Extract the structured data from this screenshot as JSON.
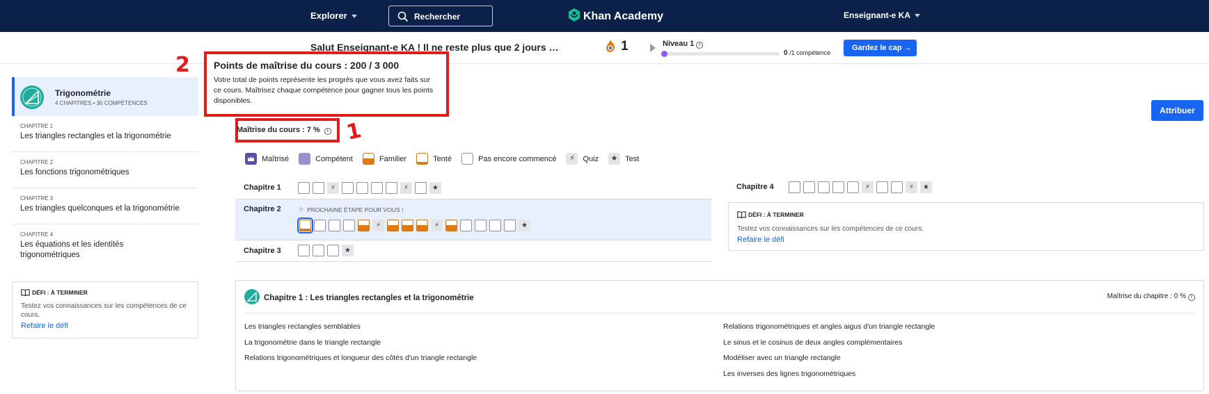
{
  "nav": {
    "explore": "Explorer",
    "search": "Rechercher",
    "logo": "Khan Academy",
    "user": "Enseignant-e KA"
  },
  "greeting": {
    "text": "Salut Enseignant-e KA ! Il ne reste plus que 2 jours …",
    "streak": "1",
    "level": "Niveau 1",
    "level_progress": 0.01,
    "competence_done": "0",
    "competence_total": "/1 compétence",
    "keep_going": "Gardez le cap"
  },
  "sidebar": {
    "course_title": "Trigonométrie",
    "course_meta": "4 CHAPITRES • 30 COMPÉTENCES",
    "units": [
      {
        "label": "CHAPITRE 1",
        "name": "Les triangles rectangles et la trigonométrie"
      },
      {
        "label": "CHAPITRE 2",
        "name": "Les fonctions trigonométriques"
      },
      {
        "label": "CHAPITRE 3",
        "name": "Les triangles quelconques et la trigonométrie"
      },
      {
        "label": "CHAPITRE 4",
        "name": "Les équations et les identités trigonométriques"
      }
    ],
    "challenge": {
      "head": "DÉFI : À TERMINER",
      "text": "Testez vos connaissances sur les compétences de ce cours.",
      "link": "Refaire le défi"
    }
  },
  "tooltip": {
    "title": "Points de maîtrise du cours : 200 / 3 000",
    "text": "Votre total de points représente les progrès que vous avez faits sur ce cours. Maîtrisez chaque compétence pour gagner tous les points disponibles."
  },
  "annotations": {
    "one": "1",
    "two": "2"
  },
  "mastery": {
    "label": "Maîtrise du cours : 7 %"
  },
  "assign": "Attribuer",
  "legend": {
    "mastered": "Maîtrisé",
    "proficient": "Compétent",
    "familiar": "Familier",
    "attempted": "Tenté",
    "not_started": "Pas encore commencé",
    "quiz": "Quiz",
    "test": "Test"
  },
  "chapters": {
    "ch1": {
      "name": "Chapitre 1",
      "boxes": [
        "e",
        "e",
        "q",
        "e",
        "e",
        "e",
        "e",
        "q",
        "e",
        "t"
      ]
    },
    "ch2": {
      "name": "Chapitre 2",
      "next": "PROCHAINE ÉTAPE POUR VOUS !",
      "boxes": [
        "a",
        "e",
        "e",
        "e",
        "f",
        "q",
        "f",
        "f",
        "f",
        "q",
        "f",
        "e",
        "e",
        "e",
        "e",
        "t"
      ]
    },
    "ch3": {
      "name": "Chapitre 3",
      "boxes": [
        "e",
        "e",
        "e",
        "t"
      ]
    },
    "ch4": {
      "name": "Chapitre 4",
      "boxes": [
        "e",
        "e",
        "e",
        "e",
        "e",
        "q",
        "e",
        "e",
        "q",
        "t"
      ]
    }
  },
  "right_challenge": {
    "head": "DÉFI : À TERMINER",
    "text": "Testez vos connaissances sur les compétences de ce cours.",
    "link": "Refaire le défi"
  },
  "detail": {
    "title": "Chapitre 1 : Les triangles rectangles et la trigonométrie",
    "mastery": "Maîtrise du chapitre : 0 %",
    "left_skills": [
      "Les triangles rectangles semblables",
      "La trigonométrie dans le triangle rectangle",
      "Relations trigonométriques et longueur des côtés d'un triangle rectangle"
    ],
    "right_skills": [
      "Relations trigonométriques et angles aigus d'un triangle rectangle",
      "Le sinus et le cosinus de deux angles complémentaires",
      "Modéliser avec un triangle rectangle",
      "Les inverses des lignes trigonométriques"
    ]
  },
  "colors": {
    "nav_bg": "#0b2149",
    "accent": "#1865f2",
    "mastered": "#5a4fa0",
    "proficient": "#9a8fce",
    "familiar": "#e07b14",
    "annotation": "#e21b1b"
  }
}
